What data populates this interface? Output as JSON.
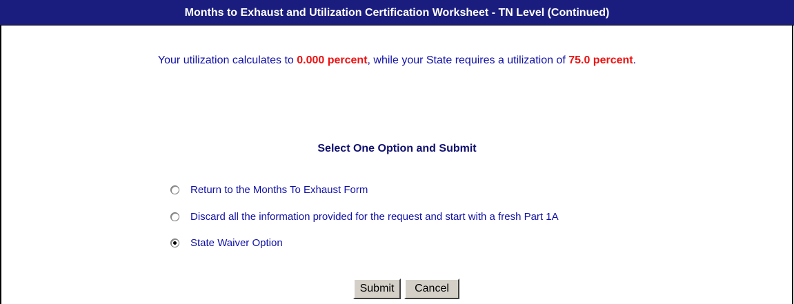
{
  "header": {
    "title": "Months to Exhaust and Utilization Certification Worksheet - TN Level (Continued)"
  },
  "utilization": {
    "prefix": "Your utilization calculates to ",
    "calculated_value": "0.000 percent",
    "middle": ", while your State requires a utilization of ",
    "required_value": "75.0 percent",
    "suffix": "."
  },
  "options_section": {
    "heading": "Select One Option and Submit",
    "options": [
      {
        "label": "Return to the Months To Exhaust Form",
        "selected": false
      },
      {
        "label": "Discard all the information provided for the request and start with a fresh Part 1A",
        "selected": false
      },
      {
        "label": "State Waiver Option",
        "selected": true
      }
    ]
  },
  "buttons": {
    "submit": "Submit",
    "cancel": "Cancel"
  },
  "colors": {
    "header_bg": "#1b1d7e",
    "text_blue": "#1010a8",
    "highlight_red": "#ee1111"
  }
}
